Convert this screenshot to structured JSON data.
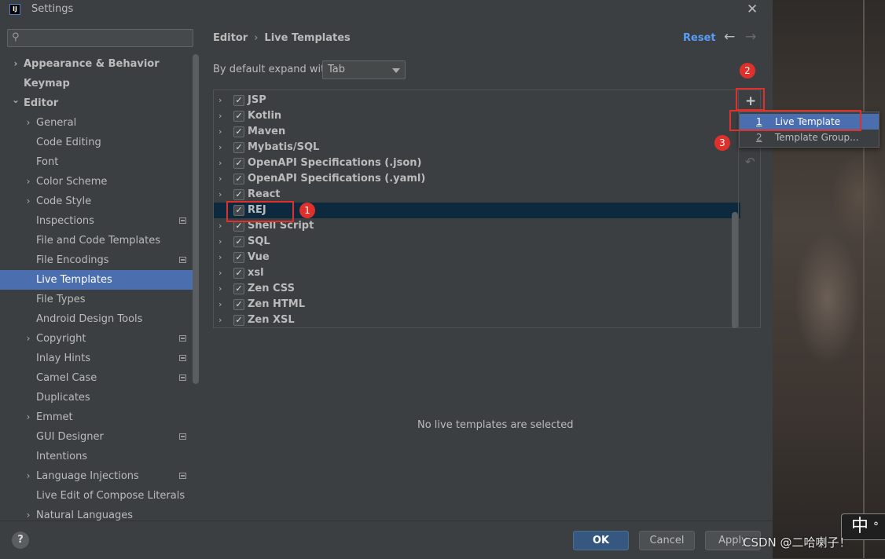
{
  "window": {
    "title": "Settings",
    "app_icon_text": "IJ"
  },
  "sidebar": {
    "search_placeholder": "",
    "items": [
      {
        "label": "Appearance & Behavior",
        "level": 0,
        "expandable": true,
        "expanded": false,
        "bold": true,
        "project": false
      },
      {
        "label": "Keymap",
        "level": 0,
        "expandable": false,
        "bold": true,
        "project": false
      },
      {
        "label": "Editor",
        "level": 0,
        "expandable": true,
        "expanded": true,
        "bold": true,
        "project": false
      },
      {
        "label": "General",
        "level": 1,
        "expandable": true,
        "expanded": false,
        "project": false
      },
      {
        "label": "Code Editing",
        "level": 1,
        "expandable": false,
        "project": false
      },
      {
        "label": "Font",
        "level": 1,
        "expandable": false,
        "project": false
      },
      {
        "label": "Color Scheme",
        "level": 1,
        "expandable": true,
        "expanded": false,
        "project": false
      },
      {
        "label": "Code Style",
        "level": 1,
        "expandable": true,
        "expanded": false,
        "project": false
      },
      {
        "label": "Inspections",
        "level": 1,
        "expandable": false,
        "project": true
      },
      {
        "label": "File and Code Templates",
        "level": 1,
        "expandable": false,
        "project": false
      },
      {
        "label": "File Encodings",
        "level": 1,
        "expandable": false,
        "project": true
      },
      {
        "label": "Live Templates",
        "level": 1,
        "expandable": false,
        "project": false,
        "selected": true
      },
      {
        "label": "File Types",
        "level": 1,
        "expandable": false,
        "project": false
      },
      {
        "label": "Android Design Tools",
        "level": 1,
        "expandable": false,
        "project": false
      },
      {
        "label": "Copyright",
        "level": 1,
        "expandable": true,
        "expanded": false,
        "project": true
      },
      {
        "label": "Inlay Hints",
        "level": 1,
        "expandable": false,
        "project": true
      },
      {
        "label": "Camel Case",
        "level": 1,
        "expandable": false,
        "project": true
      },
      {
        "label": "Duplicates",
        "level": 1,
        "expandable": false,
        "project": false
      },
      {
        "label": "Emmet",
        "level": 1,
        "expandable": true,
        "expanded": false,
        "project": false
      },
      {
        "label": "GUI Designer",
        "level": 1,
        "expandable": false,
        "project": true
      },
      {
        "label": "Intentions",
        "level": 1,
        "expandable": false,
        "project": false
      },
      {
        "label": "Language Injections",
        "level": 1,
        "expandable": true,
        "expanded": false,
        "project": true
      },
      {
        "label": "Live Edit of Compose Literals",
        "level": 1,
        "expandable": false,
        "project": false
      },
      {
        "label": "Natural Languages",
        "level": 1,
        "expandable": true,
        "expanded": false,
        "project": false
      }
    ]
  },
  "header": {
    "breadcrumb_parent": "Editor",
    "breadcrumb_separator": "›",
    "breadcrumb_current": "Live Templates",
    "reset_label": "Reset",
    "back_icon": "←",
    "forward_icon": "→"
  },
  "expand_setting": {
    "label": "By default expand with",
    "value": "Tab"
  },
  "templates": {
    "groups": [
      {
        "name": "JSP",
        "checked": true
      },
      {
        "name": "Kotlin",
        "checked": true
      },
      {
        "name": "Maven",
        "checked": true
      },
      {
        "name": "Mybatis/SQL",
        "checked": true
      },
      {
        "name": "OpenAPI Specifications (.json)",
        "checked": true
      },
      {
        "name": "OpenAPI Specifications (.yaml)",
        "checked": true
      },
      {
        "name": "React",
        "checked": true
      },
      {
        "name": "REJ",
        "checked": true,
        "selected": true,
        "expandable": false
      },
      {
        "name": "Shell Script",
        "checked": true
      },
      {
        "name": "SQL",
        "checked": true
      },
      {
        "name": "Vue",
        "checked": true
      },
      {
        "name": "xsl",
        "checked": true
      },
      {
        "name": "Zen CSS",
        "checked": true
      },
      {
        "name": "Zen HTML",
        "checked": true
      },
      {
        "name": "Zen XSL",
        "checked": true
      }
    ],
    "add_icon": "+",
    "undo_icon": "↶",
    "empty_message": "No live templates are selected"
  },
  "add_popup": {
    "items": [
      {
        "num": "1",
        "label": "Live Template",
        "highlighted": true
      },
      {
        "num": "2",
        "label": "Template Group...",
        "highlighted": false
      }
    ]
  },
  "annotations": {
    "badge1": "1",
    "badge2": "2",
    "badge3": "3",
    "accent": "#e0302b"
  },
  "footer": {
    "help_label": "?",
    "ok_label": "OK",
    "cancel_label": "Cancel",
    "apply_label": "Apply"
  },
  "overlay": {
    "ime_char": "中",
    "ime_dot": "°",
    "watermark": "CSDN @二哈喇子！"
  },
  "colors": {
    "background": "#3c3f41",
    "selection": "#4b6eaf",
    "link": "#589df6",
    "ok_button": "#365880"
  }
}
